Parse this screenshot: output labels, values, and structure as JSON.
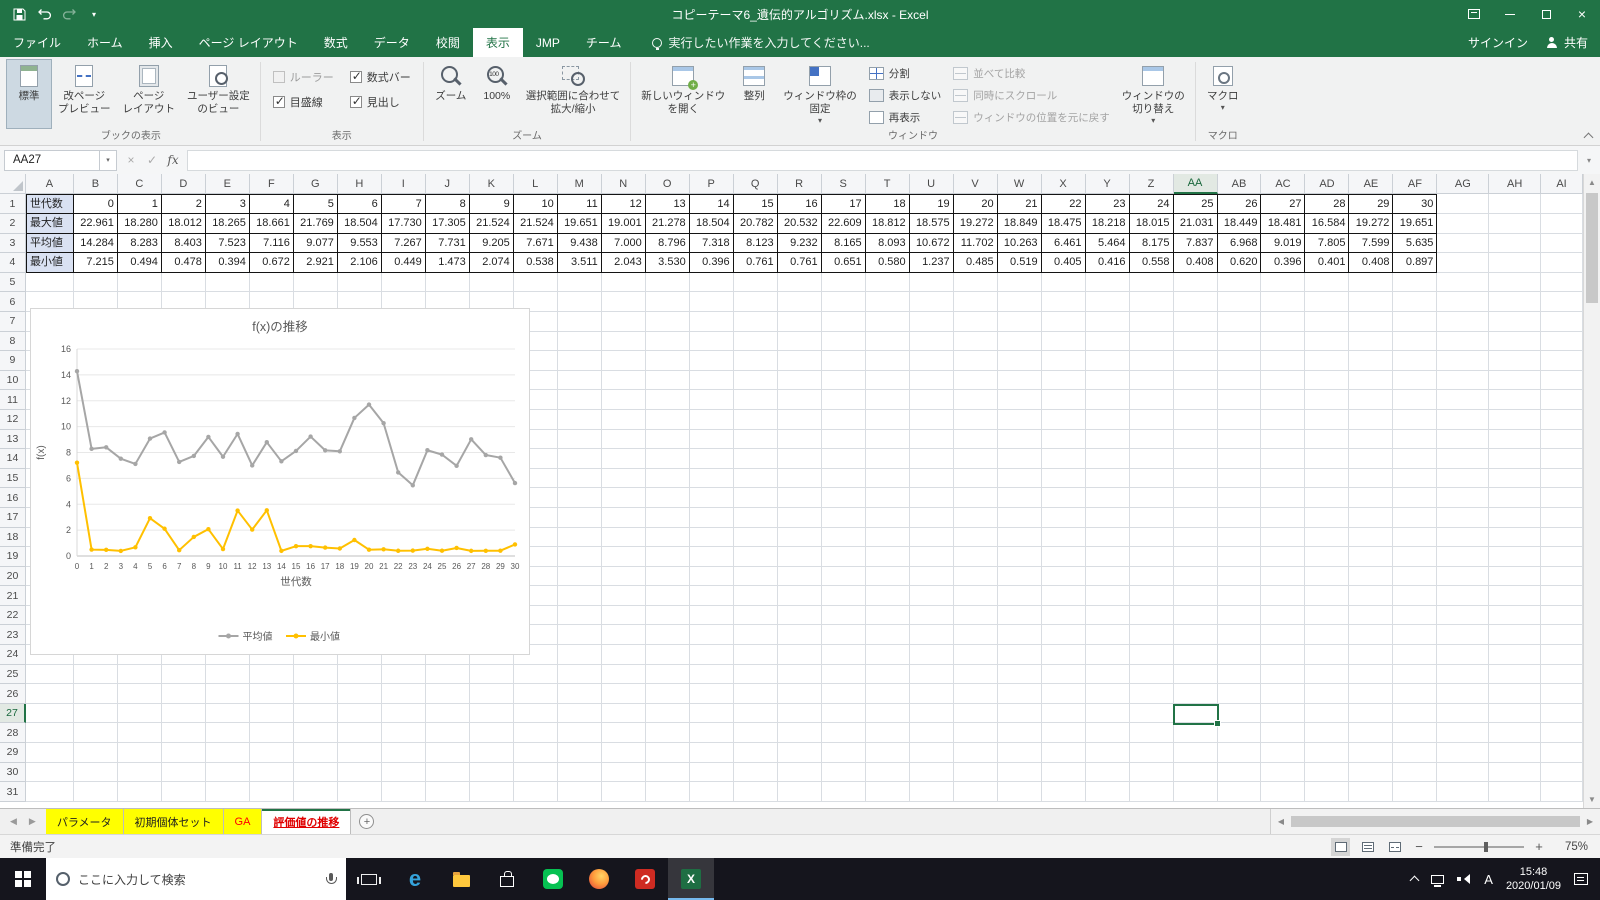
{
  "colors": {
    "excel_green": "#217346",
    "series_avg": "#A6A6A6",
    "series_min": "#FFC000",
    "tab_yellow": "#FFFF00",
    "tab_red_text": "#FF0000",
    "cell_label_fill": "#D9E1F2"
  },
  "titlebar": {
    "title": "コピーテーマ6_遺伝的アルゴリズム.xlsx - Excel"
  },
  "ribbon_tabs": {
    "file": "ファイル",
    "items": [
      "ホーム",
      "挿入",
      "ページ レイアウト",
      "数式",
      "データ",
      "校閲",
      "表示",
      "JMP",
      "チーム"
    ],
    "active": "表示",
    "tell_me": "実行したい作業を入力してください...",
    "signin": "サインイン",
    "share": "共有"
  },
  "ribbon": {
    "groups": {
      "book_views": {
        "label": "ブックの表示",
        "normal": "標準",
        "page_break": "改ページ\nプレビュー",
        "page_layout": "ページ\nレイアウト",
        "custom_views": "ユーザー設定\nのビュー"
      },
      "show": {
        "label": "表示",
        "ruler": "ルーラー",
        "formula_bar": "数式バー",
        "gridlines": "目盛線",
        "headings": "見出し"
      },
      "zoom": {
        "label": "ズーム",
        "zoom": "ズーム",
        "zoom100": "100%",
        "zoom_selection": "選択範囲に合わせて\n拡大/縮小"
      },
      "window": {
        "label": "ウィンドウ",
        "new_window": "新しいウィンドウ\nを開く",
        "arrange": "整列",
        "freeze": "ウィンドウ枠の\n固定",
        "split": "分割",
        "hide": "表示しない",
        "unhide": "再表示",
        "view_side_by_side": "並べて比較",
        "sync_scroll": "同時にスクロール",
        "reset_position": "ウィンドウの位置を元に戻す",
        "switch": "ウィンドウの\n切り替え"
      },
      "macros": {
        "label": "マクロ",
        "macros": "マクロ"
      }
    }
  },
  "formula_bar": {
    "name_box": "AA27",
    "fx_label": "fx",
    "formula": ""
  },
  "sheet": {
    "active_cell": "AA27",
    "selected_column": "AA",
    "selected_row": 27,
    "visible_rows": 31,
    "table": {
      "row1_label": "世代数",
      "row2_label": "最大値",
      "row3_label": "平均値",
      "row4_label": "最小値",
      "generations": [
        0,
        1,
        2,
        3,
        4,
        5,
        6,
        7,
        8,
        9,
        10,
        11,
        12,
        13,
        14,
        15,
        16,
        17,
        18,
        19,
        20,
        21,
        22,
        23,
        24,
        25,
        26,
        27,
        28,
        29,
        30
      ],
      "max_values": [
        22.961,
        18.28,
        18.012,
        18.265,
        18.661,
        21.769,
        18.504,
        17.73,
        17.305,
        21.524,
        21.524,
        19.651,
        19.001,
        21.278,
        18.504,
        20.782,
        20.532,
        22.609,
        18.812,
        18.575,
        19.272,
        18.849,
        18.475,
        18.218,
        18.015,
        21.031,
        18.449,
        18.481,
        16.584,
        19.272,
        19.651
      ],
      "avg_values": [
        14.284,
        8.283,
        8.403,
        7.523,
        7.116,
        9.077,
        9.553,
        7.267,
        7.731,
        9.205,
        7.671,
        9.438,
        7.0,
        8.796,
        7.318,
        8.123,
        9.232,
        8.165,
        8.093,
        10.672,
        11.702,
        10.263,
        6.461,
        5.464,
        8.175,
        7.837,
        6.968,
        9.019,
        7.805,
        7.599,
        5.635
      ],
      "min_values": [
        7.215,
        0.494,
        0.478,
        0.394,
        0.672,
        2.921,
        2.106,
        0.449,
        1.473,
        2.074,
        0.538,
        3.511,
        2.043,
        3.53,
        0.396,
        0.761,
        0.761,
        0.651,
        0.58,
        1.237,
        0.485,
        0.519,
        0.405,
        0.416,
        0.558,
        0.408,
        0.62,
        0.396,
        0.401,
        0.408,
        0.897
      ]
    }
  },
  "chart_data": {
    "type": "line",
    "title": "f(x)の推移",
    "xlabel": "世代数",
    "ylabel": "f(x)",
    "x": [
      0,
      1,
      2,
      3,
      4,
      5,
      6,
      7,
      8,
      9,
      10,
      11,
      12,
      13,
      14,
      15,
      16,
      17,
      18,
      19,
      20,
      21,
      22,
      23,
      24,
      25,
      26,
      27,
      28,
      29,
      30
    ],
    "ylim": [
      0,
      16
    ],
    "ytick_step": 2,
    "grid": true,
    "legend_position": "bottom",
    "series": [
      {
        "name": "平均値",
        "color": "#A6A6A6",
        "values": [
          14.284,
          8.283,
          8.403,
          7.523,
          7.116,
          9.077,
          9.553,
          7.267,
          7.731,
          9.205,
          7.671,
          9.438,
          7.0,
          8.796,
          7.318,
          8.123,
          9.232,
          8.165,
          8.093,
          10.672,
          11.702,
          10.263,
          6.461,
          5.464,
          8.175,
          7.837,
          6.968,
          9.019,
          7.805,
          7.599,
          5.635
        ]
      },
      {
        "name": "最小値",
        "color": "#FFC000",
        "values": [
          7.215,
          0.494,
          0.478,
          0.394,
          0.672,
          2.921,
          2.106,
          0.449,
          1.473,
          2.074,
          0.538,
          3.511,
          2.043,
          3.53,
          0.396,
          0.761,
          0.761,
          0.651,
          0.58,
          1.237,
          0.485,
          0.519,
          0.405,
          0.416,
          0.558,
          0.408,
          0.62,
          0.396,
          0.401,
          0.408,
          0.897
        ]
      }
    ]
  },
  "sheet_tabs": {
    "tabs": [
      {
        "label": "パラメータ",
        "bg": "#FFFF00",
        "fg": "#1F1F1F",
        "active": false
      },
      {
        "label": "初期個体セット",
        "bg": "#FFFF00",
        "fg": "#1F1F1F",
        "active": false
      },
      {
        "label": "GA",
        "bg": "#FFFF00",
        "fg": "#FF0000",
        "active": false
      },
      {
        "label": "評価値の推移",
        "bg": "#FFFFFF",
        "fg": "#E00000",
        "active": true
      }
    ]
  },
  "status_bar": {
    "mode": "準備完了",
    "zoom_level": "75%"
  },
  "taskbar": {
    "search_placeholder": "ここに入力して検索",
    "ime": "A",
    "clock": {
      "time": "15:48",
      "date": "2020/01/09"
    }
  },
  "icons": {
    "dropdown": "▾",
    "prev": "◀",
    "next": "▶",
    "up": "▲",
    "down": "▼",
    "cancel": "×",
    "enter": "✓",
    "close": "×",
    "add_sheet": "+",
    "zoom_in": "+",
    "zoom_out": "−",
    "expand_formula": "▾"
  }
}
